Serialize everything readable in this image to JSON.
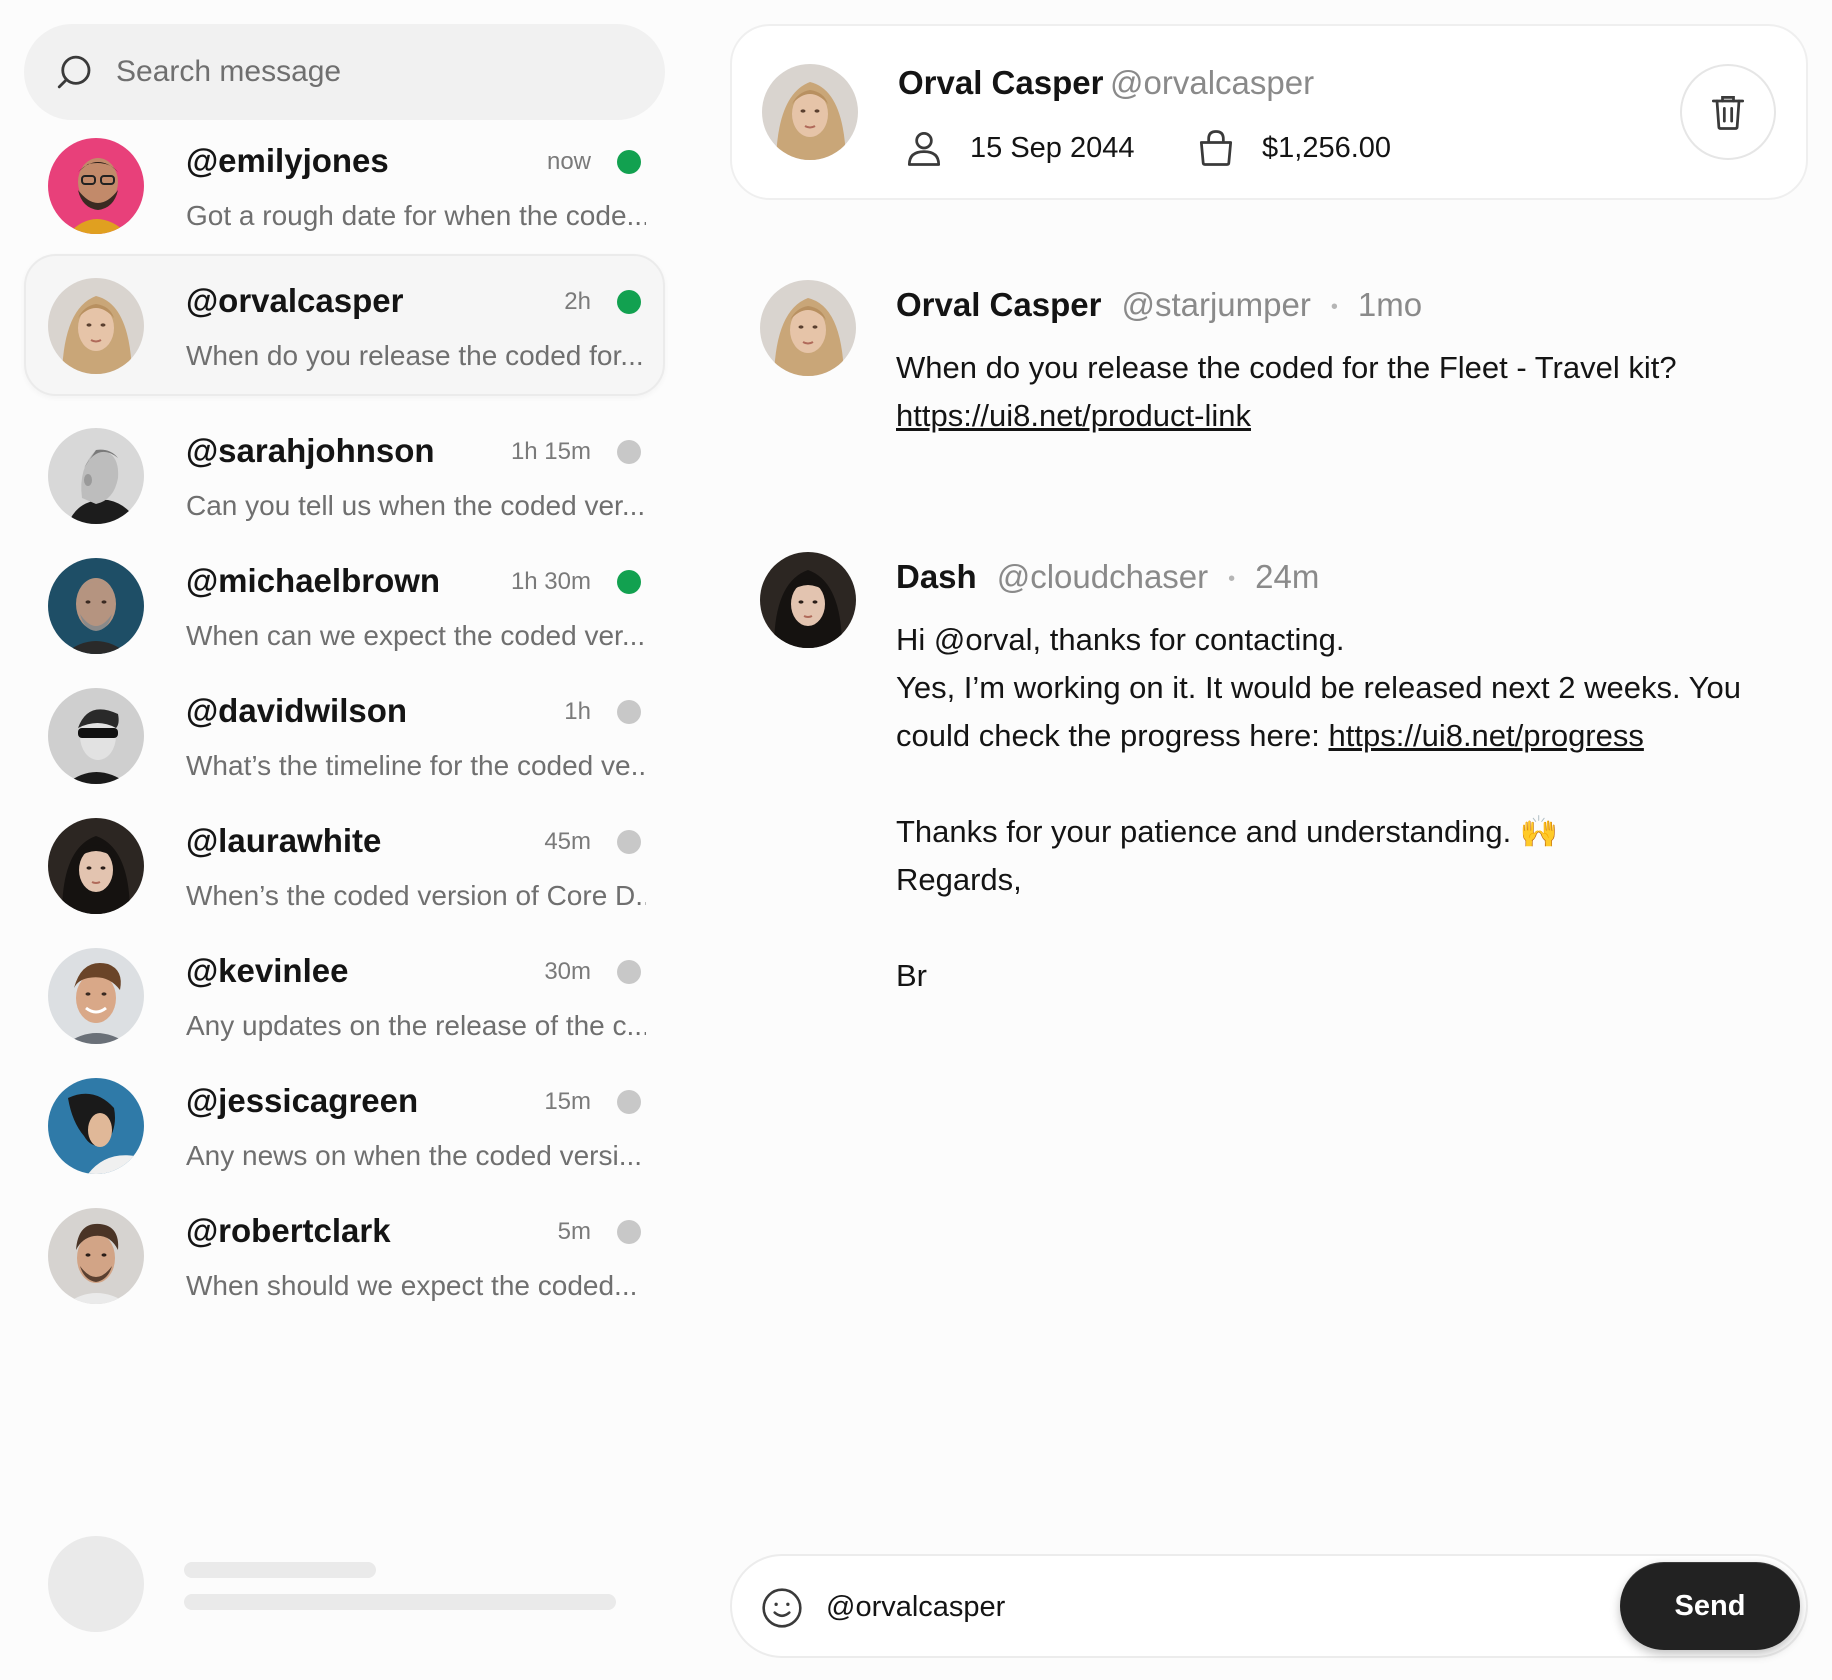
{
  "search": {
    "placeholder": "Search message",
    "icon": "search-icon"
  },
  "colors": {
    "online": "#12a150",
    "offline": "#c8c8c8",
    "send_bg": "#222222"
  },
  "conversations": [
    {
      "handle": "@emilyjones",
      "time": "now",
      "status": "online",
      "preview": "Got a rough date for when the code..."
    },
    {
      "handle": "@orvalcasper",
      "time": "2h",
      "status": "online",
      "preview": "When do you release the coded for...",
      "active": true
    },
    {
      "handle": "@sarahjohnson",
      "time": "1h 15m",
      "status": "offline",
      "preview": "Can you tell us when the coded ver..."
    },
    {
      "handle": "@michaelbrown",
      "time": "1h 30m",
      "status": "online",
      "preview": "When can we expect the coded ver..."
    },
    {
      "handle": "@davidwilson",
      "time": "1h",
      "status": "offline",
      "preview": "What’s the timeline for the coded ve..."
    },
    {
      "handle": "@laurawhite",
      "time": "45m",
      "status": "offline",
      "preview": "When’s the coded version of Core D..."
    },
    {
      "handle": "@kevinlee",
      "time": "30m",
      "status": "offline",
      "preview": "Any updates on the release of the c..."
    },
    {
      "handle": "@jessicagreen",
      "time": "15m",
      "status": "offline",
      "preview": "Any news on when the coded versi..."
    },
    {
      "handle": "@robertclark",
      "time": "5m",
      "status": "offline",
      "preview": "When should we expect the coded..."
    }
  ],
  "header": {
    "name": "Orval Casper",
    "handle": "@orvalcasper",
    "date": "15 Sep 2044",
    "amount": "$1,256.00",
    "icons": [
      "user-icon",
      "bag-icon",
      "trash-icon"
    ]
  },
  "messages": [
    {
      "name": "Orval Casper",
      "handle": "@starjumper",
      "time": "1mo",
      "text": "When do you release the coded for the Fleet - Travel kit?",
      "link": "https://ui8.net/product-link"
    },
    {
      "name": "Dash",
      "handle": "@cloudchaser",
      "time": "24m",
      "line1": "Hi @orval, thanks for contacting.",
      "line2": "Yes, I’m working on it. It would be released next 2 weeks. You could check the progress here: ",
      "link": "https://ui8.net/progress",
      "line3": "Thanks for your patience and understanding. 🙌",
      "line4": "Regards,",
      "line5": "Br"
    }
  ],
  "composer": {
    "value": "@orvalcasper",
    "send_label": "Send",
    "icon": "smile-icon"
  }
}
